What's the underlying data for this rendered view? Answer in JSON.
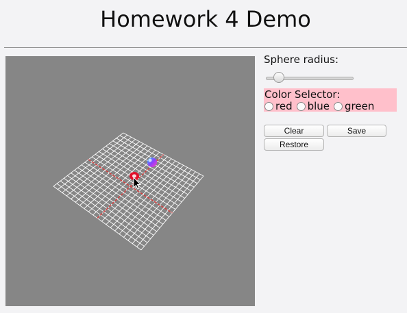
{
  "page": {
    "title": "Homework 4 Demo"
  },
  "controls": {
    "radius_label": "Sphere radius:",
    "radius_slider_value": 0.15,
    "color_selector": {
      "legend": "Color Selector:",
      "options": [
        {
          "label": "red",
          "selected": false
        },
        {
          "label": "blue",
          "selected": false
        },
        {
          "label": "green",
          "selected": false
        }
      ]
    },
    "buttons": {
      "clear": "Clear",
      "save": "Save",
      "restore": "Restore"
    }
  },
  "scene": {
    "background_color": "#868686",
    "grid_color": "#ffffff",
    "axis_color": "#e03030",
    "marker_color": "#e0102a",
    "sphere_colors": [
      "#2ad0ff",
      "#8a40ff",
      "#ff40c0"
    ]
  }
}
